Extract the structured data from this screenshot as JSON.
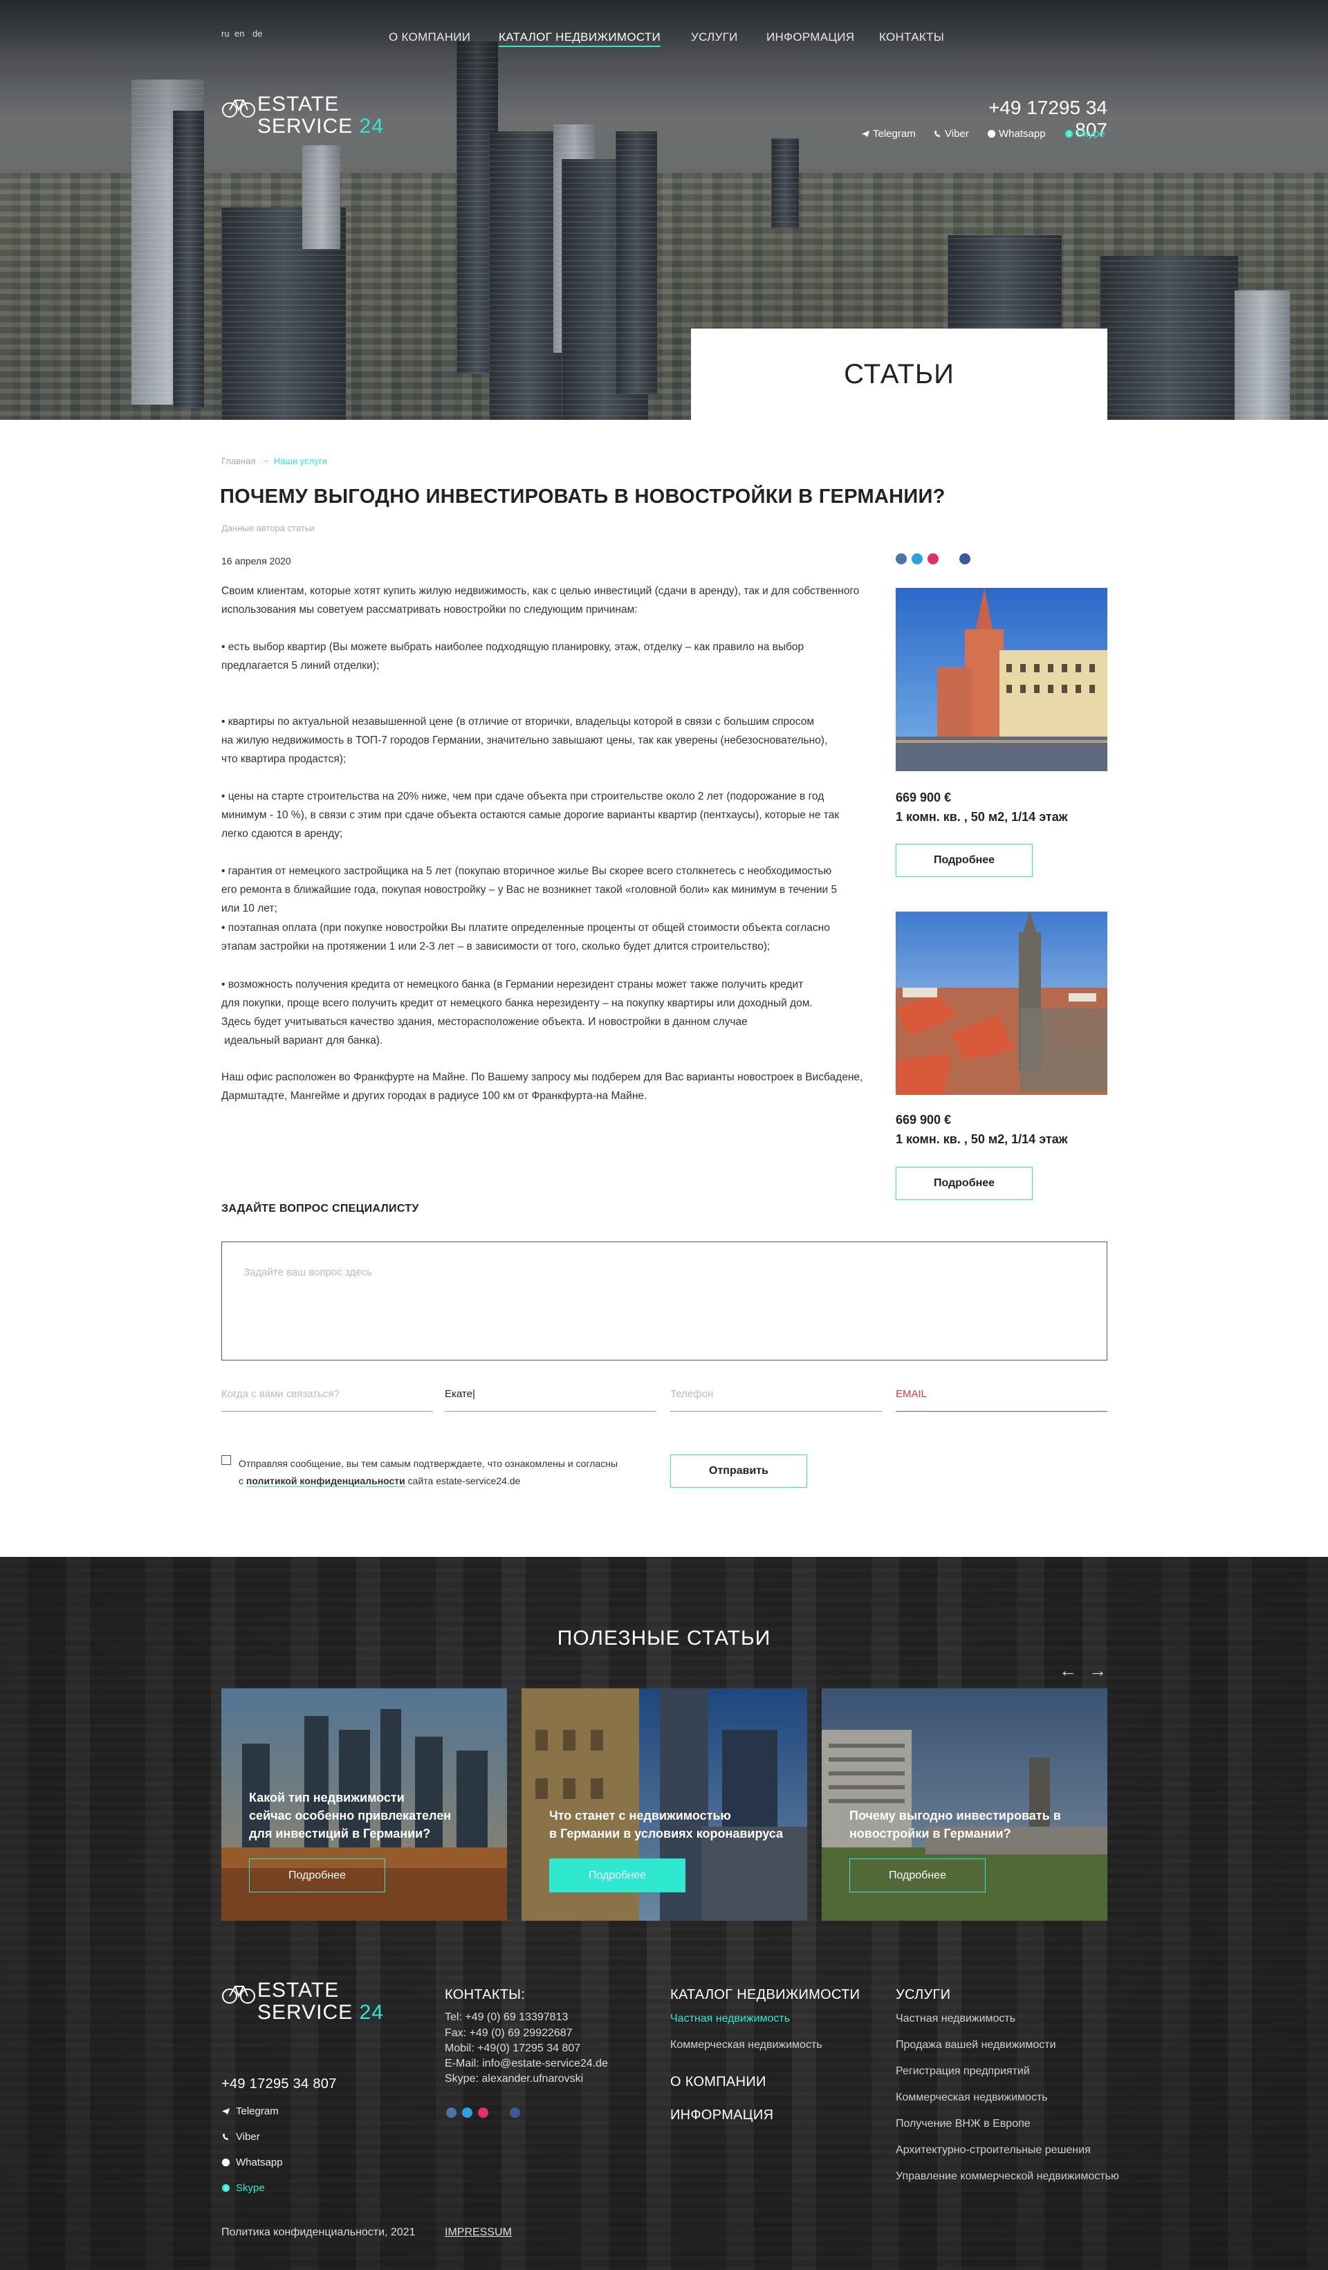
{
  "header": {
    "languages": [
      "ru",
      "en",
      "de"
    ],
    "nav": [
      "О КОМПАНИИ",
      "КАТАЛОГ НЕДВИЖИМОСТИ",
      "УСЛУГИ",
      "ИНФОРМАЦИЯ",
      "КОНТАКТЫ"
    ],
    "active_nav": "КАТАЛОГ НЕДВИЖИМОСТИ",
    "logo": {
      "line1": "ESTATE",
      "line2": "SERVICE",
      "number": "24"
    },
    "phone": "+49 17295 34 807",
    "messengers": [
      "Telegram",
      "Viber",
      "Whatsapp",
      "Skype"
    ],
    "page_title": "СТАТЬИ"
  },
  "breadcrumb": [
    "Главная",
    "Наши услуги"
  ],
  "article": {
    "title": "ПОЧЕМУ ВЫГОДНО ИНВЕСТИРОВАТЬ В НОВОСТРОЙКИ В ГЕРМАНИИ?",
    "author": "Данные автора статьи",
    "date": "16 апреля 2020",
    "paragraphs": [
      [
        "Своим клиентам, которые хотят купить жилую недвижимость, как с целью инвестиций (сдачи в аренду), так и для собственного",
        "использования мы советуем рассматривать новостройки по следующим причинам:"
      ],
      [
        "• есть выбор квартир (Вы можете выбрать наиболее подходящую планировку, этаж, отделку – как правило на выбор",
        "предлагается 5 линий отделки);"
      ],
      [
        "• квартиры по актуальной незавышенной цене (в отличие от вторички, владельцы которой в связи с большим спросом",
        "на жилую недвижимость в ТОП-7 городов Германии, значительно завышают цены, так как уверены (небезосновательно),",
        "что квартира продастся);"
      ],
      [
        "• цены на старте строительства на 20% ниже, чем при сдаче объекта при строительстве около 2 лет (подорожание в год",
        "минимум - 10 %), в связи с этим при сдаче объекта остаются самые дорогие варианты квартир (пентхаусы), которые не так",
        "легко сдаются в аренду;"
      ],
      [
        "• гарантия от немецкого застройщика на 5 лет (покупаю вторичное жилье Вы скорее всего столкнетесь с необходимостью",
        "его ремонта в ближайшие года, покупая новостройку – у Вас не возникнет такой «головной боли» как минимум в течении 5",
        "или 10 лет;"
      ],
      [
        "• поэтапная оплата (при покупке новостройки Вы платите определенные проценты от общей стоимости объекта согласно",
        "этапам застройки на протяжении 1 или 2-3 лет – в зависимости от того, сколько будет длится строительство);"
      ],
      [
        "• возможность получения кредита от немецкого банка (в Германии нерезидент страны может также получить кредит",
        "для покупки, проще всего получить кредит от немецкого банка нерезиденту – на покупку квартиры или доходный дом.",
        "Здесь будет учитываться качество здания, месторасположение объекта. И новостройки в данном случае",
        " идеальный вариант для банка)."
      ],
      [
        "Наш офис расположен во Франкфурте на Майне. По Вашему запросу мы подберем для Вас варианты новостроек в Висбадене,",
        "Дармштадте, Мангейме и других городах в радиусе 100 км от Франкфурта-на Майне."
      ]
    ]
  },
  "listings": [
    {
      "price": "669 900 €",
      "details": "1 комн. кв. , 50 м2, 1/14 этаж",
      "button": "Подробнее"
    },
    {
      "price": "669 900 €",
      "details": "1 комн. кв. , 50 м2, 1/14 этаж",
      "button": "Подробнее"
    }
  ],
  "question_form": {
    "title": "ЗАДАЙТЕ ВОПРОС СПЕЦИАЛИСТУ",
    "textarea_placeholder": "Задайте ваш вопрос здесь",
    "when_placeholder": "Когда с вами связаться?",
    "name_value": "Екате|",
    "phone_placeholder": "Телефон",
    "email_placeholder": "EMAIL",
    "consent_line1": "Отправляя сообщение, вы тем самым подтверждаете, что ознакомлены и согласны",
    "consent_prefix": "с ",
    "consent_link": "политикой конфиденциальности",
    "consent_suffix": " сайта estate-service24.de",
    "submit": "Отправить"
  },
  "useful_articles": {
    "title": "ПОЛЕЗНЫЕ СТАТЬИ",
    "prev_arrow": "←",
    "next_arrow": "→",
    "items": [
      {
        "lines": [
          "Какой тип недвижимости",
          "сейчас особенно привлекателен",
          "для инвестиций в Германии?"
        ],
        "button": "Подробнее"
      },
      {
        "lines": [
          "Что станет с недвижимостью",
          "в Германии в условиях коронавируса"
        ],
        "button": "Подробнее"
      },
      {
        "lines": [
          "Почему выгодно инвестировать в",
          "новостройки в Германии?"
        ],
        "button": "Подробнее"
      }
    ]
  },
  "footer": {
    "phone": "+49 17295 34 807",
    "messengers": [
      "Telegram",
      "Viber",
      "Whatsapp",
      "Skype"
    ],
    "contacts_title": "КОНТАКТЫ:",
    "contacts": [
      "Tel: +49 (0) 69 13397813",
      "Fax: +49 (0) 69 29922687",
      "Mobil: +49(0) 17295 34 807",
      "E-Mail: info@estate-service24.de",
      "Skype: alexander.ufnarovski"
    ],
    "catalog_title": "КАТАЛОГ НЕДВИЖИМОСТИ",
    "catalog_links": [
      "Частная недвижимость",
      "Коммерческая недвижимость"
    ],
    "about": "О КОМПАНИИ",
    "info": "ИНФОРМАЦИЯ",
    "services_title": "УСЛУГИ",
    "services": [
      "Частная недвижимость",
      "Продажа вашей недвижимости",
      "Регистрация предприятий",
      "Коммерческая недвижимость",
      "Получение ВНЖ в Европе",
      "Архитектурно-строительные решения",
      "Управление коммерческой недвижимостью"
    ],
    "policy": "Политика конфиденциальности, 2021",
    "impressum": "IMPRESSUM"
  },
  "colors": {
    "accent": "#2ee8d0",
    "error": "#e23b3b",
    "dark": "#2a2a2a"
  }
}
